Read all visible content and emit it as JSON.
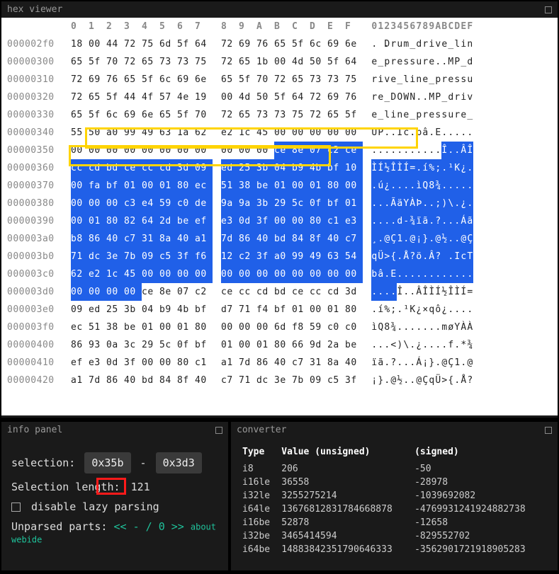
{
  "hex": {
    "title": "hex viewer",
    "col_header_hex": [
      "0",
      "1",
      "2",
      "3",
      "4",
      "5",
      "6",
      "7",
      "8",
      "9",
      "A",
      "B",
      "C",
      "D",
      "E",
      "F"
    ],
    "col_header_ascii": "0123456789ABCDEF",
    "yellow_highlight": {
      "start": 834,
      "end": 858
    },
    "blue_selection": {
      "start": 859,
      "end": 979
    },
    "rows": [
      {
        "offset": "000002f0",
        "hex": [
          "18",
          "00",
          "44",
          "72",
          "75",
          "6d",
          "5f",
          "64",
          "72",
          "69",
          "76",
          "65",
          "5f",
          "6c",
          "69",
          "6e"
        ],
        "ascii": [
          ".",
          " .",
          "D",
          "r",
          "u",
          "m",
          "_",
          "d",
          "r",
          "i",
          "v",
          "e",
          "_",
          "l",
          "i",
          "n"
        ],
        "sel": []
      },
      {
        "offset": "00000300",
        "hex": [
          "65",
          "5f",
          "70",
          "72",
          "65",
          "73",
          "73",
          "75",
          "72",
          "65",
          "1b",
          "00",
          "4d",
          "50",
          "5f",
          "64"
        ],
        "ascii": [
          "e",
          "_",
          "p",
          "r",
          "e",
          "s",
          "s",
          "u",
          "r",
          "e",
          ".",
          ".",
          "M",
          "P",
          "_",
          "d"
        ],
        "sel": []
      },
      {
        "offset": "00000310",
        "hex": [
          "72",
          "69",
          "76",
          "65",
          "5f",
          "6c",
          "69",
          "6e",
          "65",
          "5f",
          "70",
          "72",
          "65",
          "73",
          "73",
          "75"
        ],
        "ascii": [
          "r",
          "i",
          "v",
          "e",
          "_",
          "l",
          "i",
          "n",
          "e",
          "_",
          "p",
          "r",
          "e",
          "s",
          "s",
          "u"
        ],
        "sel": []
      },
      {
        "offset": "00000320",
        "hex": [
          "72",
          "65",
          "5f",
          "44",
          "4f",
          "57",
          "4e",
          "19",
          "00",
          "4d",
          "50",
          "5f",
          "64",
          "72",
          "69",
          "76"
        ],
        "ascii": [
          "r",
          "e",
          "_",
          "D",
          "O",
          "W",
          "N",
          ".",
          ".",
          "M",
          "P",
          "_",
          "d",
          "r",
          "i",
          "v"
        ],
        "sel": []
      },
      {
        "offset": "00000330",
        "hex": [
          "65",
          "5f",
          "6c",
          "69",
          "6e",
          "65",
          "5f",
          "70",
          "72",
          "65",
          "73",
          "73",
          "75",
          "72",
          "65",
          "5f"
        ],
        "ascii": [
          "e",
          "_",
          "l",
          "i",
          "n",
          "e",
          "_",
          "p",
          "r",
          "e",
          "s",
          "s",
          "u",
          "r",
          "e",
          "_"
        ],
        "sel": []
      },
      {
        "offset": "00000340",
        "hex": [
          "55",
          "50",
          "a0",
          "99",
          "49",
          "63",
          "1a",
          "62",
          "e2",
          "1c",
          "45",
          "00",
          "00",
          "00",
          "00",
          "00"
        ],
        "ascii": [
          "U",
          "P",
          ".",
          ".",
          "I",
          "c",
          ".",
          "b",
          "â",
          ".",
          "E",
          ".",
          ".",
          ".",
          ".",
          "."
        ],
        "sel": []
      },
      {
        "offset": "00000350",
        "hex": [
          "00",
          "00",
          "00",
          "00",
          "00",
          "00",
          "00",
          "00",
          "00",
          "00",
          "00",
          "ce",
          "8e",
          "07",
          "c2",
          "ce"
        ],
        "ascii": [
          ".",
          ".",
          ".",
          ".",
          ".",
          ".",
          ".",
          ".",
          ".",
          ".",
          ".",
          "Î",
          ".",
          ".",
          "Â",
          "Î"
        ],
        "sel": [
          11,
          12,
          13,
          14,
          15
        ]
      },
      {
        "offset": "00000360",
        "hex": [
          "cc",
          "cd",
          "bd",
          "ce",
          "cc",
          "cd",
          "3d",
          "09",
          "ed",
          "25",
          "3b",
          "04",
          "b9",
          "4b",
          "bf",
          "10"
        ],
        "ascii": [
          "Ì",
          "Í",
          "½",
          "Î",
          "Ì",
          "Í",
          "=",
          ".",
          "í",
          "%",
          ";",
          ".",
          "¹",
          "K",
          "¿",
          "."
        ],
        "sel": [
          0,
          1,
          2,
          3,
          4,
          5,
          6,
          7,
          8,
          9,
          10,
          11,
          12,
          13,
          14,
          15
        ]
      },
      {
        "offset": "00000370",
        "hex": [
          "00",
          "fa",
          "bf",
          "01",
          "00",
          "01",
          "80",
          "ec",
          "51",
          "38",
          "be",
          "01",
          "00",
          "01",
          "80",
          "00"
        ],
        "ascii": [
          ".",
          "ú",
          "¿",
          ".",
          ".",
          ".",
          ".",
          "ì",
          "Q",
          "8",
          "¾",
          ".",
          ".",
          ".",
          ".",
          "."
        ],
        "sel": [
          0,
          1,
          2,
          3,
          4,
          5,
          6,
          7,
          8,
          9,
          10,
          11,
          12,
          13,
          14,
          15
        ]
      },
      {
        "offset": "00000380",
        "hex": [
          "00",
          "00",
          "00",
          "c3",
          "e4",
          "59",
          "c0",
          "de",
          "9a",
          "9a",
          "3b",
          "29",
          "5c",
          "0f",
          "bf",
          "01"
        ],
        "ascii": [
          ".",
          ".",
          ".",
          "Ã",
          "ä",
          "Y",
          "À",
          "Þ",
          ".",
          ".",
          ";",
          ")",
          "\\",
          ".",
          "¿",
          "."
        ],
        "sel": [
          0,
          1,
          2,
          3,
          4,
          5,
          6,
          7,
          8,
          9,
          10,
          11,
          12,
          13,
          14,
          15
        ]
      },
      {
        "offset": "00000390",
        "hex": [
          "00",
          "01",
          "80",
          "82",
          "64",
          "2d",
          "be",
          "ef",
          "e3",
          "0d",
          "3f",
          "00",
          "00",
          "80",
          "c1",
          "e3"
        ],
        "ascii": [
          ".",
          ".",
          ".",
          ".",
          "d",
          "-",
          "¾",
          "ï",
          "ã",
          ".",
          "?",
          ".",
          ".",
          ".",
          "Á",
          "ã"
        ],
        "sel": [
          0,
          1,
          2,
          3,
          4,
          5,
          6,
          7,
          8,
          9,
          10,
          11,
          12,
          13,
          14,
          15
        ]
      },
      {
        "offset": "000003a0",
        "hex": [
          "b8",
          "86",
          "40",
          "c7",
          "31",
          "8a",
          "40",
          "a1",
          "7d",
          "86",
          "40",
          "bd",
          "84",
          "8f",
          "40",
          "c7"
        ],
        "ascii": [
          "¸",
          ".",
          "@",
          "Ç",
          "1",
          ".",
          "@",
          "¡",
          "}",
          ".",
          "@",
          "½",
          ".",
          ".",
          "@",
          "Ç"
        ],
        "sel": [
          0,
          1,
          2,
          3,
          4,
          5,
          6,
          7,
          8,
          9,
          10,
          11,
          12,
          13,
          14,
          15
        ]
      },
      {
        "offset": "000003b0",
        "hex": [
          "71",
          "dc",
          "3e",
          "7b",
          "09",
          "c5",
          "3f",
          "f6",
          "12",
          "c2",
          "3f",
          "a0",
          "99",
          "49",
          "63",
          "54"
        ],
        "ascii": [
          "q",
          "Ü",
          ">",
          "{",
          ".",
          "Å",
          "?",
          "ö",
          ".",
          "Â",
          "?",
          " ",
          ".",
          "I",
          "c",
          "T"
        ],
        "sel": [
          0,
          1,
          2,
          3,
          4,
          5,
          6,
          7,
          8,
          9,
          10,
          11,
          12,
          13,
          14,
          15
        ]
      },
      {
        "offset": "000003c0",
        "hex": [
          "62",
          "e2",
          "1c",
          "45",
          "00",
          "00",
          "00",
          "00",
          "00",
          "00",
          "00",
          "00",
          "00",
          "00",
          "00",
          "00"
        ],
        "ascii": [
          "b",
          "â",
          ".",
          "E",
          ".",
          ".",
          ".",
          ".",
          ".",
          ".",
          ".",
          ".",
          ".",
          ".",
          ".",
          "."
        ],
        "sel": [
          0,
          1,
          2,
          3,
          4,
          5,
          6,
          7,
          8,
          9,
          10,
          11,
          12,
          13,
          14,
          15
        ]
      },
      {
        "offset": "000003d0",
        "hex": [
          "00",
          "00",
          "00",
          "00",
          "ce",
          "8e",
          "07",
          "c2",
          "ce",
          "cc",
          "cd",
          "bd",
          "ce",
          "cc",
          "cd",
          "3d"
        ],
        "ascii": [
          ".",
          ".",
          ".",
          ".",
          "Î",
          ".",
          ".",
          "Â",
          "Î",
          "Ì",
          "Í",
          "½",
          "Î",
          "Ì",
          "Í",
          "="
        ],
        "sel": [
          0,
          1,
          2,
          3
        ]
      },
      {
        "offset": "000003e0",
        "hex": [
          "09",
          "ed",
          "25",
          "3b",
          "04",
          "b9",
          "4b",
          "bf",
          "d7",
          "71",
          "f4",
          "bf",
          "01",
          "00",
          "01",
          "80"
        ],
        "ascii": [
          ".",
          "í",
          "%",
          ";",
          ".",
          "¹",
          "K",
          "¿",
          "×",
          "q",
          "ô",
          "¿",
          ".",
          ".",
          ".",
          "."
        ],
        "sel": []
      },
      {
        "offset": "000003f0",
        "hex": [
          "ec",
          "51",
          "38",
          "be",
          "01",
          "00",
          "01",
          "80",
          "00",
          "00",
          "00",
          "6d",
          "f8",
          "59",
          "c0",
          "c0"
        ],
        "ascii": [
          "ì",
          "Q",
          "8",
          "¾",
          ".",
          ".",
          ".",
          ".",
          ".",
          ".",
          ".",
          "m",
          "ø",
          "Y",
          "À",
          "À"
        ],
        "sel": []
      },
      {
        "offset": "00000400",
        "hex": [
          "86",
          "93",
          "0a",
          "3c",
          "29",
          "5c",
          "0f",
          "bf",
          "01",
          "00",
          "01",
          "80",
          "66",
          "9d",
          "2a",
          "be"
        ],
        "ascii": [
          ".",
          ".",
          ".",
          "<",
          ")",
          "\\",
          ".",
          "¿",
          ".",
          ".",
          ".",
          ".",
          "f",
          ".",
          "*",
          "¾"
        ],
        "sel": []
      },
      {
        "offset": "00000410",
        "hex": [
          "ef",
          "e3",
          "0d",
          "3f",
          "00",
          "00",
          "80",
          "c1",
          "a1",
          "7d",
          "86",
          "40",
          "c7",
          "31",
          "8a",
          "40"
        ],
        "ascii": [
          "ï",
          "ã",
          ".",
          "?",
          ".",
          ".",
          ".",
          "Á",
          "¡",
          "}",
          ".",
          "@",
          "Ç",
          "1",
          ".",
          "@"
        ],
        "sel": []
      },
      {
        "offset": "00000420",
        "hex": [
          "a1",
          "7d",
          "86",
          "40",
          "bd",
          "84",
          "8f",
          "40",
          "c7",
          "71",
          "dc",
          "3e",
          "7b",
          "09",
          "c5",
          "3f"
        ],
        "ascii": [
          "¡",
          "}",
          ".",
          "@",
          "½",
          ".",
          ".",
          "@",
          "Ç",
          "q",
          "Ü",
          ">",
          "{",
          ".",
          "Å",
          "?"
        ],
        "sel": []
      }
    ]
  },
  "info": {
    "title": "info panel",
    "selection_label": "selection:",
    "selection_start": "0x35b",
    "selection_dash": "-",
    "selection_end": "0x3d3",
    "length_label": "Selection length:",
    "length_value": "121",
    "disable_lazy_label": "disable lazy parsing",
    "unparsed_label": "Unparsed parts:",
    "unparsed_nav": "<< - / 0 >>",
    "about_label": "about webide"
  },
  "converter": {
    "title": "converter",
    "header_type": "Type",
    "header_unsigned": "Value (unsigned)",
    "header_signed": "(signed)",
    "rows": [
      {
        "type": "i8",
        "u": "206",
        "s": "-50"
      },
      {
        "type": "i16le",
        "u": "36558",
        "s": "-28978"
      },
      {
        "type": "i32le",
        "u": "3255275214",
        "s": "-1039692082"
      },
      {
        "type": "i64le",
        "u": "13676812831784668878",
        "s": "-4769931241924882738"
      },
      {
        "type": "i16be",
        "u": "52878",
        "s": "-12658"
      },
      {
        "type": "i32be",
        "u": "3465414594",
        "s": "-829552702"
      },
      {
        "type": "i64be",
        "u": "14883842351790646333",
        "s": "-3562901721918905283"
      }
    ]
  }
}
